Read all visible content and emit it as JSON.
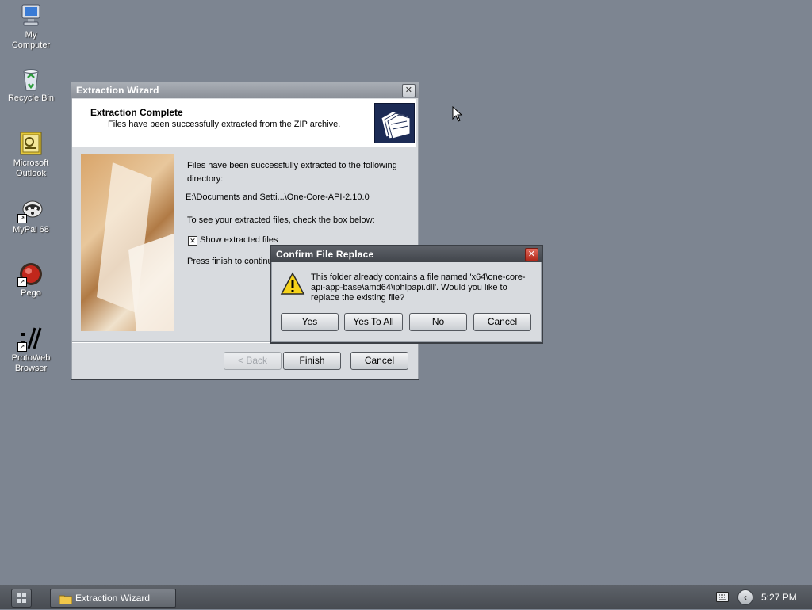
{
  "desktop": {
    "icons": [
      {
        "label": "My\nComputer",
        "icon": "computer-icon"
      },
      {
        "label": "Recycle Bin",
        "icon": "recycle-bin-icon"
      },
      {
        "label": "Microsoft\nOutlook",
        "icon": "outlook-icon"
      },
      {
        "label": "MyPal 68",
        "icon": "mypal-icon"
      },
      {
        "label": "Pego",
        "icon": "pego-icon"
      },
      {
        "label": "ProtoWeb\nBrowser",
        "icon": "protoweb-icon"
      }
    ]
  },
  "wizard": {
    "title": "Extraction Wizard",
    "header_title": "Extraction Complete",
    "header_subtitle": "Files have been successfully extracted from the ZIP archive.",
    "body_text": "Files have been successfully extracted to the following directory:",
    "path": "E:\\Documents and Setti...\\One-Core-API-2.10.0",
    "check_hint": "To see your extracted files, check the box below:",
    "checkbox_label": "Show extracted files",
    "checkbox_checked": true,
    "finish_hint": "Press finish to continu",
    "back_label": "< Back",
    "finish_label": "Finish",
    "cancel_label": "Cancel"
  },
  "confirm": {
    "title": "Confirm File Replace",
    "message": "This folder already contains a file named 'x64\\one-core-api-app-base\\amd64\\iphlpapi.dll'.  Would you like to replace the existing file?",
    "yes_label": "Yes",
    "yes_to_all_label": "Yes To All",
    "no_label": "No",
    "cancel_label": "Cancel"
  },
  "taskbar": {
    "task_label": "Extraction Wizard",
    "clock": "5:27 PM"
  },
  "colors": {
    "desktop": "#7d8591",
    "title_active": "#41454b",
    "title_inactive": "#8b9098"
  }
}
